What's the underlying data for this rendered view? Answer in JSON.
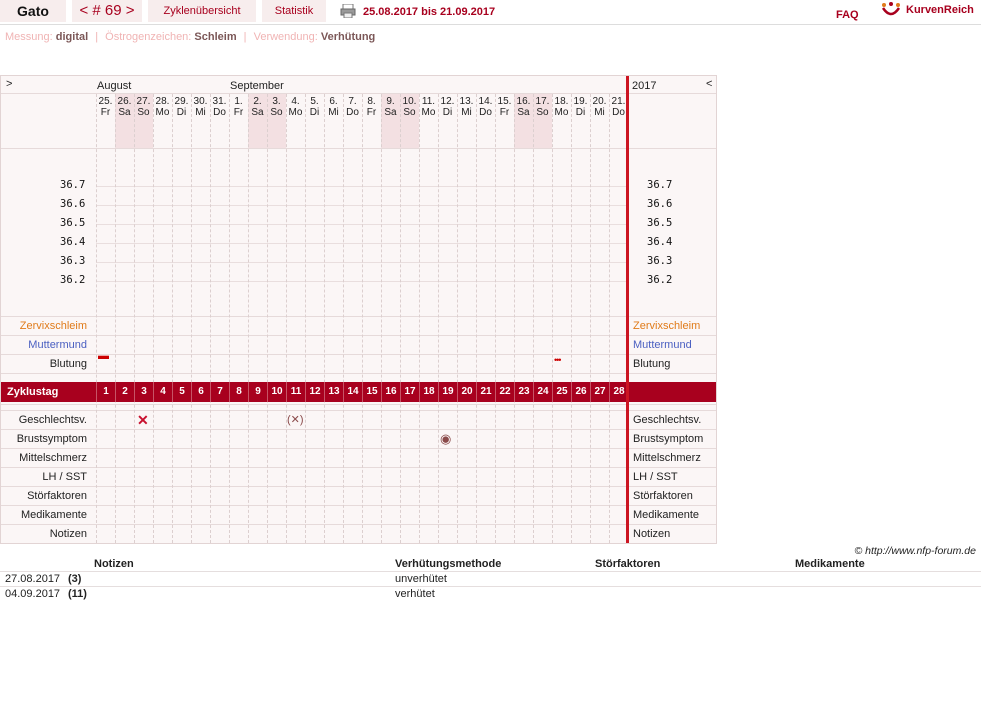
{
  "header": {
    "name": "Gato",
    "cycle_tab": "< # 69 >",
    "overview_tab": "Zyklenübersicht",
    "stats_tab": "Statistik",
    "date_range": "25.08.2017 bis 21.09.2017",
    "faq": "FAQ",
    "logo_text": "KurvenReich"
  },
  "settings": {
    "measure_label": "Messung:",
    "measure_value": "digital",
    "sign_label": "Östrogenzeichen:",
    "sign_value": "Schleim",
    "use_label": "Verwendung:",
    "use_value": "Verhütung"
  },
  "chart": {
    "nav_prev": ">",
    "nav_next": "<",
    "month1": "August",
    "month2": "September",
    "year": "2017",
    "days": [
      {
        "d": "25.",
        "w": "Fr"
      },
      {
        "d": "26.",
        "w": "Sa"
      },
      {
        "d": "27.",
        "w": "So"
      },
      {
        "d": "28.",
        "w": "Mo"
      },
      {
        "d": "29.",
        "w": "Di"
      },
      {
        "d": "30.",
        "w": "Mi"
      },
      {
        "d": "31.",
        "w": "Do"
      },
      {
        "d": "1.",
        "w": "Fr"
      },
      {
        "d": "2.",
        "w": "Sa"
      },
      {
        "d": "3.",
        "w": "So"
      },
      {
        "d": "4.",
        "w": "Mo"
      },
      {
        "d": "5.",
        "w": "Di"
      },
      {
        "d": "6.",
        "w": "Mi"
      },
      {
        "d": "7.",
        "w": "Do"
      },
      {
        "d": "8.",
        "w": "Fr"
      },
      {
        "d": "9.",
        "w": "Sa"
      },
      {
        "d": "10.",
        "w": "So"
      },
      {
        "d": "11.",
        "w": "Mo"
      },
      {
        "d": "12.",
        "w": "Di"
      },
      {
        "d": "13.",
        "w": "Mi"
      },
      {
        "d": "14.",
        "w": "Do"
      },
      {
        "d": "15.",
        "w": "Fr"
      },
      {
        "d": "16.",
        "w": "Sa"
      },
      {
        "d": "17.",
        "w": "So"
      },
      {
        "d": "18.",
        "w": "Mo"
      },
      {
        "d": "19.",
        "w": "Di"
      },
      {
        "d": "20.",
        "w": "Mi"
      },
      {
        "d": "21.",
        "w": "Do"
      }
    ],
    "temps": [
      "36.7",
      "36.6",
      "36.5",
      "36.4",
      "36.3",
      "36.2"
    ],
    "row_labels": {
      "cervix": "Zervixschleim",
      "mouth": "Muttermund",
      "bleeding": "Blutung",
      "cycle_day": "Zyklustag",
      "sex": "Geschlechtsv.",
      "breast": "Brustsymptom",
      "mittel": "Mittelschmerz",
      "lh": "LH / SST",
      "disturb": "Störfaktoren",
      "meds": "Medikamente",
      "notes": "Notizen"
    },
    "cycle_days": [
      "1",
      "2",
      "3",
      "4",
      "5",
      "6",
      "7",
      "8",
      "9",
      "10",
      "11",
      "12",
      "13",
      "14",
      "15",
      "16",
      "17",
      "18",
      "19",
      "20",
      "21",
      "22",
      "23",
      "24",
      "25",
      "26",
      "27",
      "28"
    ],
    "marks": {
      "sex_unprotected": "✕",
      "sex_protected": "(✕)",
      "breast_symbol": "◉",
      "bleed_strong": "▬",
      "bleed_spotting": "•••"
    }
  },
  "copyright": "© http://www.nfp-forum.de",
  "notes_table": {
    "headers": [
      "Notizen",
      "Verhütungsmethode",
      "Störfaktoren",
      "Medikamente"
    ],
    "rows": [
      {
        "date": "27.08.2017",
        "day": "(3)",
        "method": "unverhütet"
      },
      {
        "date": "04.09.2017",
        "day": "(11)",
        "method": "verhütet"
      }
    ]
  },
  "colors": {
    "accent": "#a8001e",
    "cervix": "#e07b1a",
    "mouth": "#4a5fc1"
  }
}
